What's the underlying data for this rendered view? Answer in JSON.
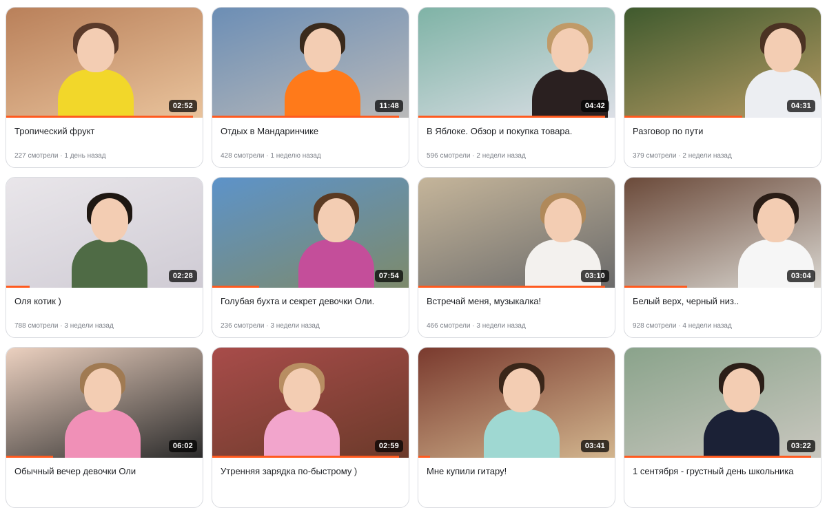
{
  "videos": [
    {
      "title": "Тропический фрукт",
      "views": "227 смотрели",
      "age": "1 день назад",
      "duration": "02:52",
      "progress": 0.95,
      "colors": {
        "bg1": "#b9805a",
        "bg2": "#e9c39c",
        "shirt": "#f2d72a",
        "hair": "#5a3a2a"
      }
    },
    {
      "title": "Отдых в Мандаринчике",
      "views": "428 смотрели",
      "age": "1 неделю назад",
      "duration": "11:48",
      "progress": 0.95,
      "colors": {
        "bg1": "#6c8eb5",
        "bg2": "#b9b9b9",
        "shirt": "#ff7a1a",
        "hair": "#3a2a1c"
      }
    },
    {
      "title": "В Яблоке. Обзор и покупка товара.",
      "views": "596 смотрели",
      "age": "2 недели назад",
      "duration": "04:42",
      "progress": 0.95,
      "colors": {
        "bg1": "#7fb3a6",
        "bg2": "#dcdfe6",
        "shirt": "#2a2020",
        "hair": "#c09a68"
      }
    },
    {
      "title": "Разговор по пути",
      "views": "379 смотрели",
      "age": "2 недели назад",
      "duration": "04:31",
      "progress": 0.6,
      "colors": {
        "bg1": "#3f5a2e",
        "bg2": "#b59a63",
        "shirt": "#eceef2",
        "hair": "#4b3223"
      }
    },
    {
      "title": "Оля котик )",
      "views": "788 смотрели",
      "age": "3 недели назад",
      "duration": "02:28",
      "progress": 0.12,
      "colors": {
        "bg1": "#e9e6ea",
        "bg2": "#cfcbd4",
        "shirt": "#4f6b45",
        "hair": "#1e1712"
      }
    },
    {
      "title": "Голубая бухта и секрет девочки Оли.",
      "views": "236 смотрели",
      "age": "3 недели назад",
      "duration": "07:54",
      "progress": 0.24,
      "colors": {
        "bg1": "#5d93c9",
        "bg2": "#7d8a6b",
        "shirt": "#c44e9a",
        "hair": "#5a3a22"
      }
    },
    {
      "title": "Встречай меня, музыкалка!",
      "views": "466 смотрели",
      "age": "3 недели назад",
      "duration": "03:10",
      "progress": 0.95,
      "colors": {
        "bg1": "#c5b59a",
        "bg2": "#6b6b6b",
        "shirt": "#f3f1ee",
        "hair": "#b0895a"
      }
    },
    {
      "title": "Белый верх, черный низ..",
      "views": "928 смотрели",
      "age": "4 недели назад",
      "duration": "03:04",
      "progress": 0.32,
      "colors": {
        "bg1": "#6b4a3a",
        "bg2": "#d9d6d0",
        "shirt": "#f6f6f6",
        "hair": "#2a1d16"
      }
    },
    {
      "title": "Обычный вечер девочки Оли",
      "views": "",
      "age": "",
      "duration": "06:02",
      "progress": 0.24,
      "colors": {
        "bg1": "#ecd1c0",
        "bg2": "#2b2b2b",
        "shirt": "#f090b7",
        "hair": "#a07a52"
      }
    },
    {
      "title": "Утренняя зарядка по-быстрому )",
      "views": "",
      "age": "",
      "duration": "02:59",
      "progress": 0.95,
      "colors": {
        "bg1": "#a84c4a",
        "bg2": "#6b3a2a",
        "shirt": "#f2a5cc",
        "hair": "#b88e62"
      }
    },
    {
      "title": "Мне купили гитару!",
      "views": "",
      "age": "",
      "duration": "03:41",
      "progress": 0.06,
      "colors": {
        "bg1": "#7a3a2e",
        "bg2": "#d2b58e",
        "shirt": "#9fd8d2",
        "hair": "#3a2619"
      }
    },
    {
      "title": "1 сентября - грустный день школьника",
      "views": "",
      "age": "",
      "duration": "03:22",
      "progress": 0.95,
      "colors": {
        "bg1": "#8aa38b",
        "bg2": "#c9c7bf",
        "shirt": "#1b2136",
        "hair": "#2b1e17"
      }
    }
  ],
  "meta_separator": " · "
}
